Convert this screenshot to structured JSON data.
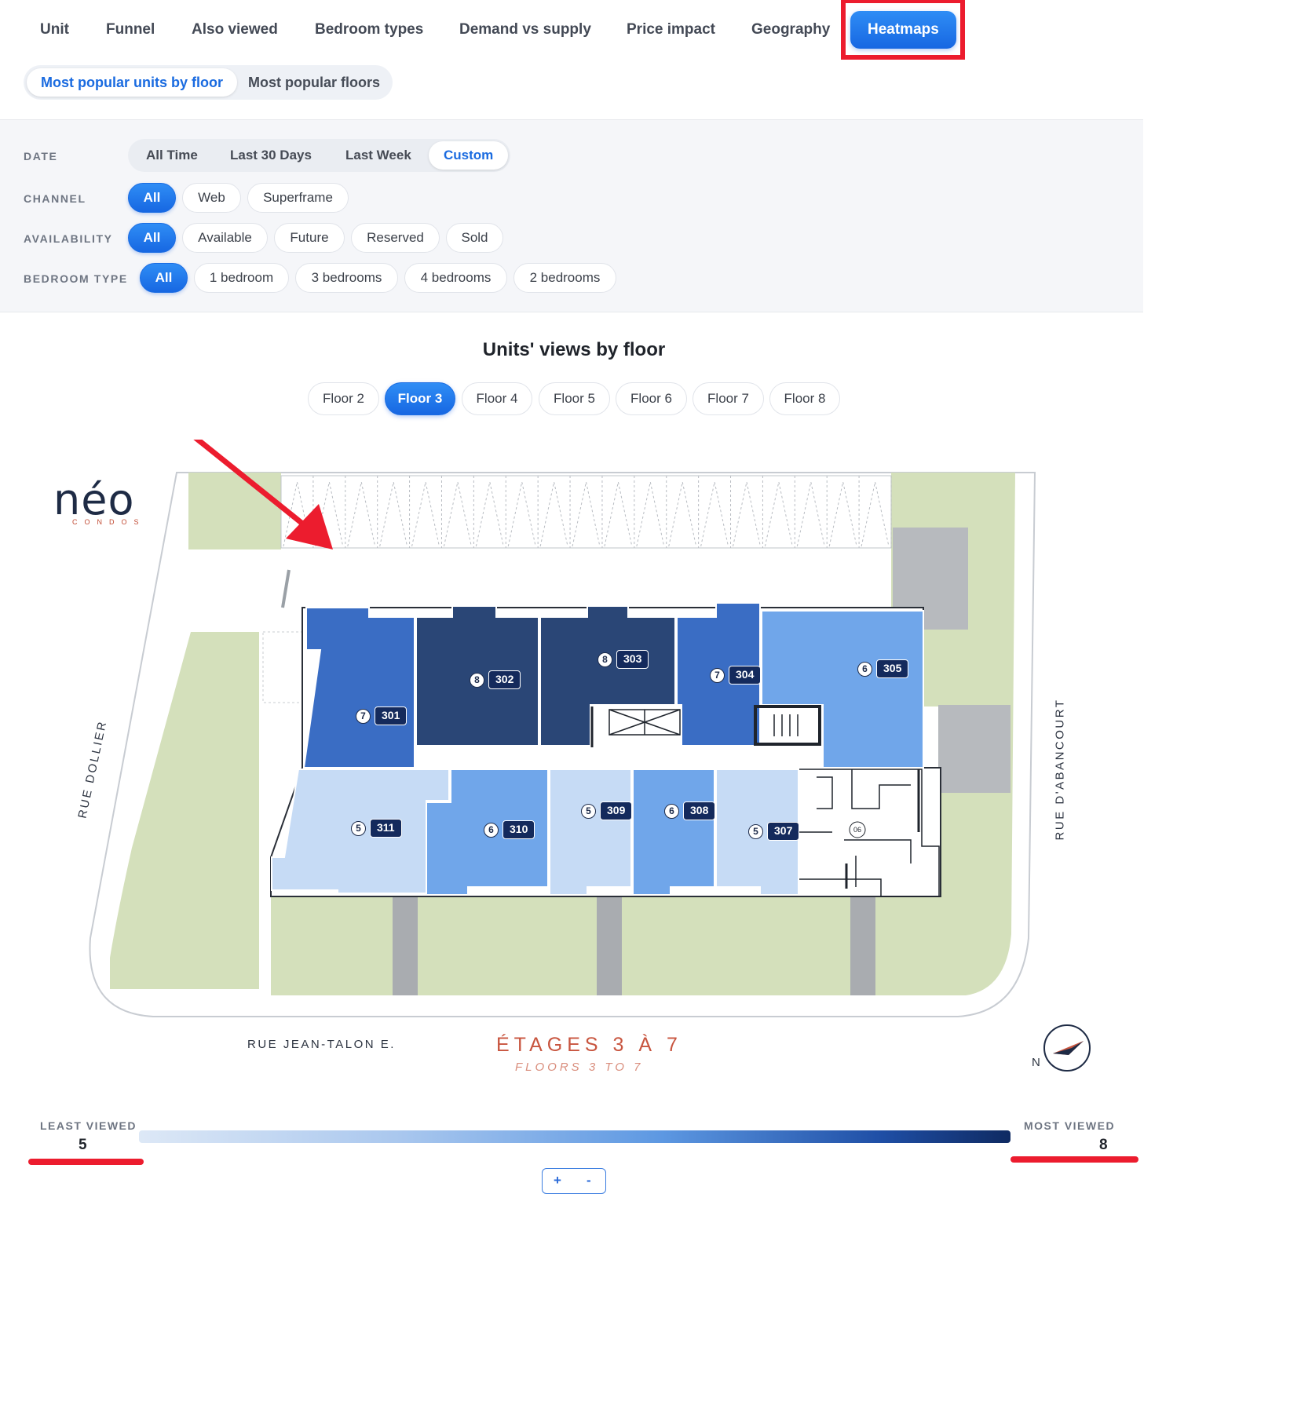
{
  "nav": {
    "tabs": [
      "Unit",
      "Funnel",
      "Also viewed",
      "Bedroom types",
      "Demand vs supply",
      "Price impact",
      "Geography",
      "Heatmaps"
    ],
    "active": "Heatmaps"
  },
  "subtabs": {
    "active": "Most popular units by floor",
    "inactive": "Most popular floors"
  },
  "filters": {
    "date_label": "DATE",
    "date_options": [
      "All Time",
      "Last 30 Days",
      "Last Week",
      "Custom"
    ],
    "channel_label": "CHANNEL",
    "channel_options": [
      "All",
      "Web",
      "Superframe"
    ],
    "availability_label": "AVAILABILITY",
    "availability_options": [
      "All",
      "Available",
      "Future",
      "Reserved",
      "Sold"
    ],
    "bedroom_label": "BEDROOM TYPE",
    "bedroom_options": [
      "All",
      "1 bedroom",
      "3 bedrooms",
      "4 bedrooms",
      "2 bedrooms"
    ]
  },
  "heatmap": {
    "title": "Units' views by floor",
    "floors": [
      "Floor 2",
      "Floor 3",
      "Floor 4",
      "Floor 5",
      "Floor 6",
      "Floor 7",
      "Floor 8"
    ],
    "active_floor": "Floor 3",
    "units": [
      {
        "unit": "301",
        "views": 7
      },
      {
        "unit": "302",
        "views": 8
      },
      {
        "unit": "303",
        "views": 8
      },
      {
        "unit": "304",
        "views": 7
      },
      {
        "unit": "305",
        "views": 6
      },
      {
        "unit": "311",
        "views": 5
      },
      {
        "unit": "310",
        "views": 6
      },
      {
        "unit": "309",
        "views": 5
      },
      {
        "unit": "308",
        "views": 6
      },
      {
        "unit": "307",
        "views": 5
      }
    ],
    "colors": {
      "v5": "#c6dbf5",
      "v6": "#70a6ea",
      "v7": "#3a6dc4",
      "v8": "#2a4676"
    }
  },
  "plan": {
    "logo": "néo",
    "logo_sub": "CONDOS",
    "street_west": "RUE DOLLIER",
    "street_east": "RUE D'ABANCOURT",
    "street_south": "RUE JEAN-TALON E.",
    "etages": "ÉTAGES 3 À 7",
    "floors_text": "FLOORS 3 TO 7",
    "compass": "N",
    "unit_06": "06"
  },
  "legend": {
    "least_label": "LEAST VIEWED",
    "least_value": "5",
    "most_label": "MOST VIEWED",
    "most_value": "8"
  },
  "zoom": {
    "plus": "+",
    "minus": "-"
  }
}
